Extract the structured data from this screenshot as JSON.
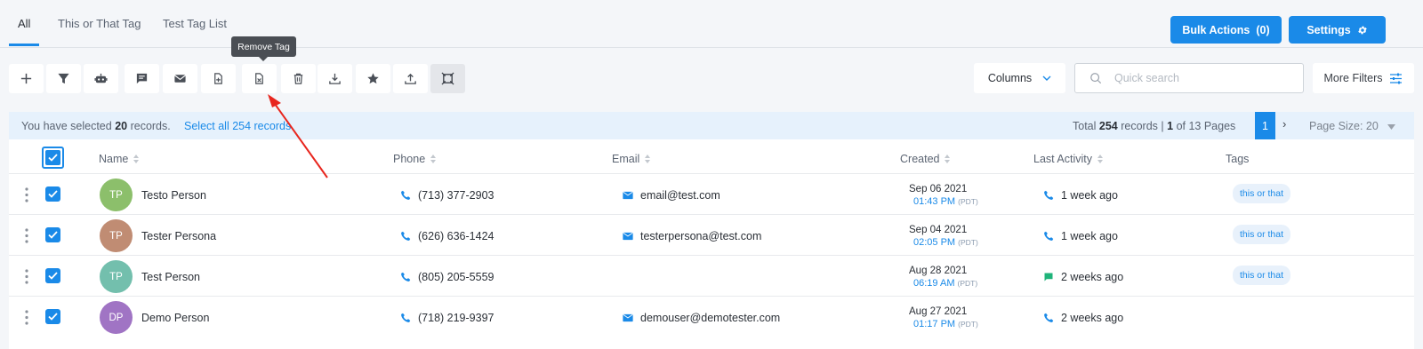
{
  "tabs": [
    {
      "label": "All",
      "active": true
    },
    {
      "label": "This or That Tag",
      "active": false
    },
    {
      "label": "Test Tag List",
      "active": false
    }
  ],
  "header_buttons": {
    "bulk_actions": "Bulk Actions",
    "bulk_count": "(0)",
    "settings": "Settings"
  },
  "toolbar": {
    "icons": [
      "plus-icon",
      "filter-icon",
      "robot-icon",
      "message-icon",
      "envelope-icon",
      "add-tag-icon",
      "remove-tag-icon",
      "trash-icon",
      "download-icon",
      "star-icon",
      "upload-icon",
      "merge-icon"
    ],
    "tooltip": "Remove Tag",
    "columns_label": "Columns",
    "search_placeholder": "Quick search",
    "more_filters_label": "More Filters"
  },
  "selection": {
    "prefix": "You have selected",
    "count": "20",
    "suffix": "records.",
    "select_all": "Select all 254 records."
  },
  "pagination": {
    "total_prefix": "Total",
    "total": "254",
    "records_word": "records",
    "current": "1",
    "of_pages": "of 13 Pages",
    "page_label": "1",
    "page_size": "Page Size: 20"
  },
  "columns": {
    "name": "Name",
    "phone": "Phone",
    "email": "Email",
    "created": "Created",
    "last_activity": "Last Activity",
    "tags": "Tags"
  },
  "rows": [
    {
      "initials": "TP",
      "avatar_color": "#8cbf6b",
      "name": "Testo Person",
      "phone": "(713) 377-2903",
      "email": "email@test.com",
      "created_date": "Sep 06 2021",
      "created_time": "01:43 PM",
      "tz": "(PDT)",
      "activity": "1 week ago",
      "activity_icon": "phone-icon",
      "tag": "this or that"
    },
    {
      "initials": "TP",
      "avatar_color": "#c08c73",
      "name": "Tester Persona",
      "phone": "(626) 636-1424",
      "email": "testerpersona@test.com",
      "created_date": "Sep 04 2021",
      "created_time": "02:05 PM",
      "tz": "(PDT)",
      "activity": "1 week ago",
      "activity_icon": "phone-icon",
      "tag": "this or that"
    },
    {
      "initials": "TP",
      "avatar_color": "#73bfad",
      "name": "Test Person",
      "phone": "(805) 205-5559",
      "email": "",
      "created_date": "Aug 28 2021",
      "created_time": "06:19 AM",
      "tz": "(PDT)",
      "activity": "2 weeks ago",
      "activity_icon": "chat-icon",
      "tag": "this or that"
    },
    {
      "initials": "DP",
      "avatar_color": "#a074c4",
      "name": "Demo Person",
      "phone": "(718) 219-9397",
      "email": "demouser@demotester.com",
      "created_date": "Aug 27 2021",
      "created_time": "01:17 PM",
      "tz": "(PDT)",
      "activity": "2 weeks ago",
      "activity_icon": "phone-icon",
      "tag": ""
    }
  ],
  "colors": {
    "accent": "#1a8ae8",
    "annotation_arrow": "#e8261e",
    "chat": "#1fb37a"
  }
}
